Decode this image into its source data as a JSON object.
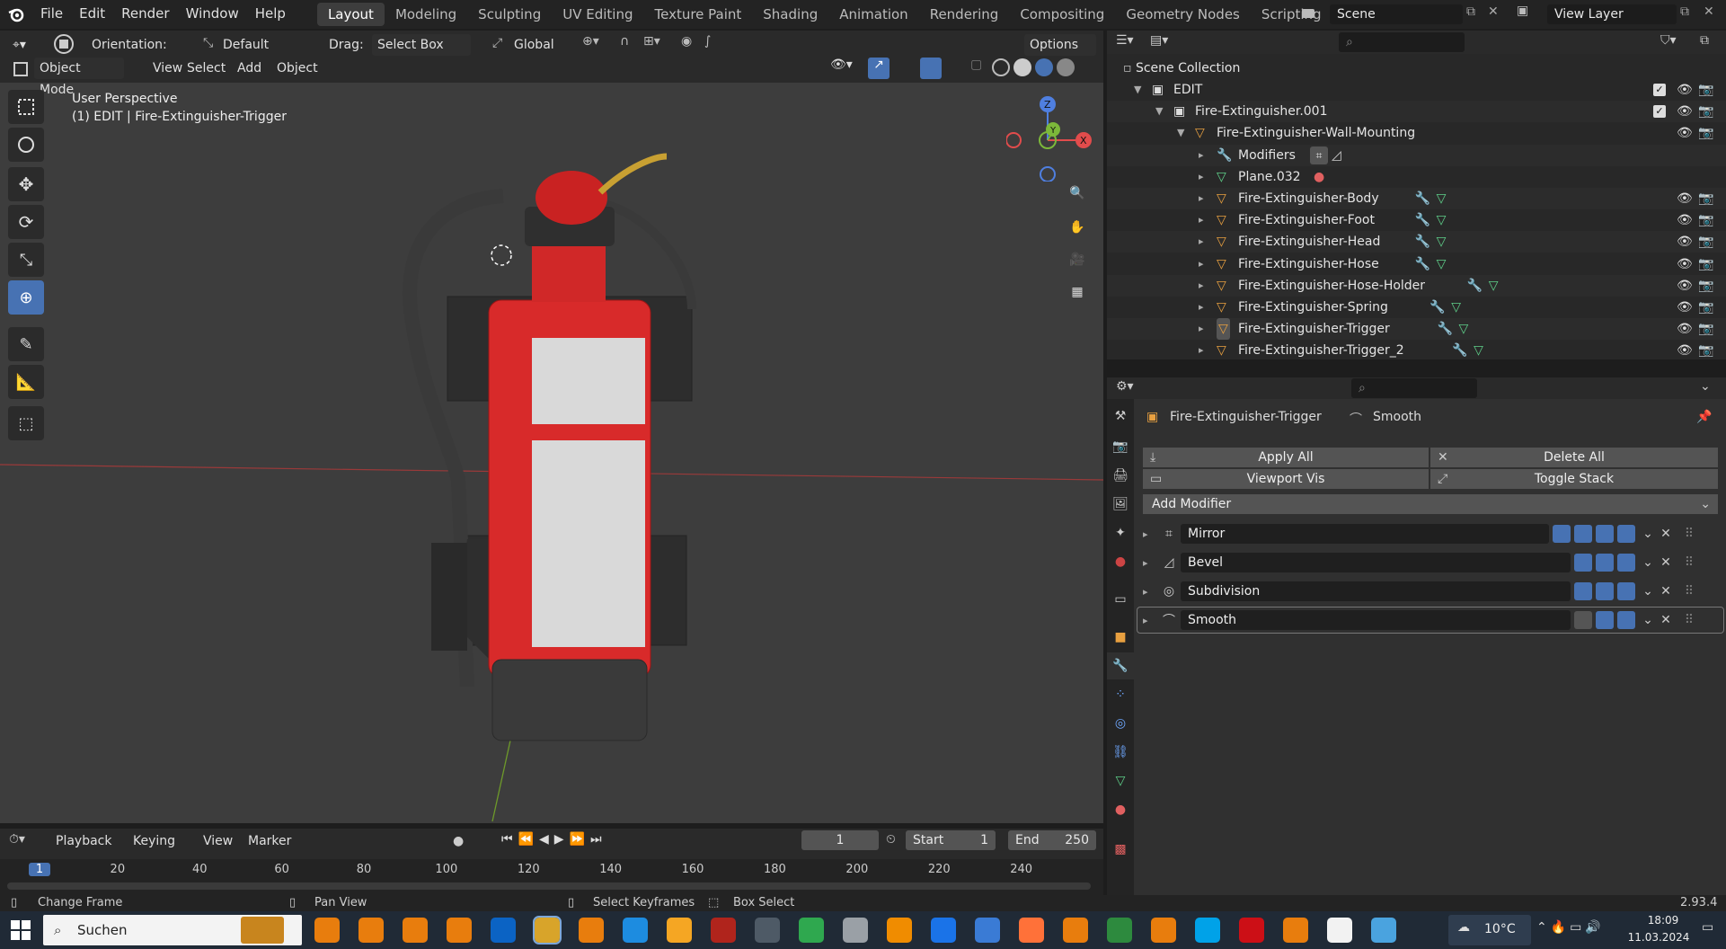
{
  "topbar": {
    "menus": [
      "File",
      "Edit",
      "Render",
      "Window",
      "Help"
    ],
    "workspaces": [
      "Layout",
      "Modeling",
      "Sculpting",
      "UV Editing",
      "Texture Paint",
      "Shading",
      "Animation",
      "Rendering",
      "Compositing",
      "Geometry Nodes",
      "Scripting"
    ],
    "active_workspace": "Layout",
    "scene": "Scene",
    "view_layer": "View Layer"
  },
  "viewport": {
    "orientation_label": "Orientation:",
    "orientation_value": "Default",
    "drag_label": "Drag:",
    "drag_value": "Select Box",
    "transform_value": "Global",
    "options_label": "Options",
    "mode": "Object Mode",
    "menus": [
      "View",
      "Select",
      "Add",
      "Object"
    ],
    "info_line1": "User Perspective",
    "info_line2": "(1) EDIT | Fire-Extinguisher-Trigger",
    "gizmo": {
      "z": "Z",
      "y": "Y",
      "x": "X"
    }
  },
  "outliner": {
    "scene_collection": "Scene Collection",
    "rows": [
      {
        "label": "EDIT"
      },
      {
        "label": "Fire-Extinguisher.001"
      },
      {
        "label": "Fire-Extinguisher-Wall-Mounting"
      },
      {
        "label": "Modifiers"
      },
      {
        "label": "Plane.032"
      },
      {
        "label": "Fire-Extinguisher-Body"
      },
      {
        "label": "Fire-Extinguisher-Foot"
      },
      {
        "label": "Fire-Extinguisher-Head"
      },
      {
        "label": "Fire-Extinguisher-Hose"
      },
      {
        "label": "Fire-Extinguisher-Hose-Holder"
      },
      {
        "label": "Fire-Extinguisher-Spring"
      },
      {
        "label": "Fire-Extinguisher-Trigger"
      },
      {
        "label": "Fire-Extinguisher-Trigger_2"
      }
    ]
  },
  "properties": {
    "object_name": "Fire-Extinguisher-Trigger",
    "active_modifier": "Smooth",
    "apply_all": "Apply All",
    "delete_all": "Delete All",
    "viewport_vis": "Viewport Vis",
    "toggle_stack": "Toggle Stack",
    "add_modifier": "Add Modifier",
    "modifiers": [
      {
        "name": "Mirror"
      },
      {
        "name": "Bevel"
      },
      {
        "name": "Subdivision"
      },
      {
        "name": "Smooth"
      }
    ]
  },
  "timeline": {
    "menus": [
      "Playback",
      "Keying",
      "View",
      "Marker"
    ],
    "current_frame": "1",
    "start_label": "Start",
    "start_value": "1",
    "end_label": "End",
    "end_value": "250",
    "ruler": [
      "1",
      "20",
      "40",
      "60",
      "80",
      "100",
      "120",
      "140",
      "160",
      "180",
      "200",
      "220",
      "240"
    ]
  },
  "statusbar": {
    "change_frame": "Change Frame",
    "pan_view": "Pan View",
    "select_keyframes": "Select Keyframes",
    "box_select": "Box Select",
    "version": "2.93.4"
  },
  "taskbar": {
    "search": "Suchen",
    "weather": "10°C",
    "time": "18:09",
    "date": "11.03.2024"
  }
}
